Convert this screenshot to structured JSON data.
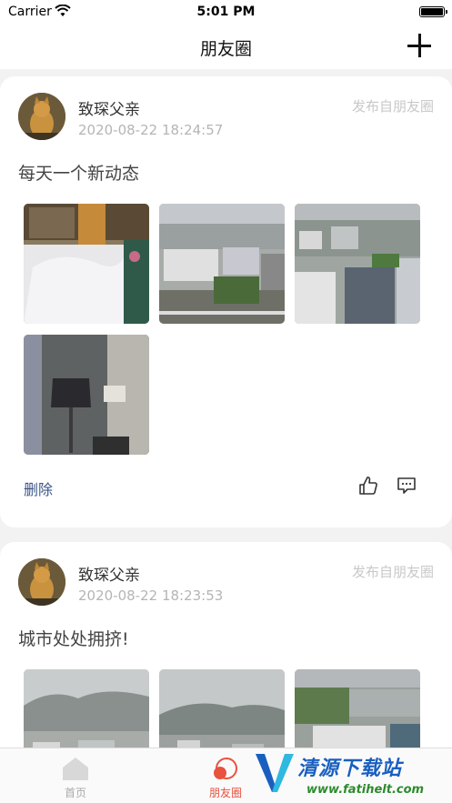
{
  "status_bar": {
    "carrier": "Carrier",
    "time": "5:01 PM"
  },
  "nav": {
    "title": "朋友圈"
  },
  "posts": [
    {
      "username": "致琛父亲",
      "timestamp": "2020-08-22 18:24:57",
      "source": "发布自朋友圈",
      "content": "每天一个新动态",
      "delete_label": "删除",
      "photo_count": 4
    },
    {
      "username": "致琛父亲",
      "timestamp": "2020-08-22 18:23:53",
      "source": "发布自朋友圈",
      "content": "城市处处拥挤!",
      "photo_count": 3
    }
  ],
  "tabs": [
    {
      "label": "首页",
      "icon": "home-icon",
      "active": false
    },
    {
      "label": "朋友圈",
      "icon": "moments-icon",
      "active": true
    }
  ],
  "colors": {
    "accent": "#e8523f",
    "link": "#3b5488",
    "muted": "#b5b5b5"
  },
  "watermark": {
    "text": "清源下载站",
    "url": "www.fatihelt.com"
  }
}
